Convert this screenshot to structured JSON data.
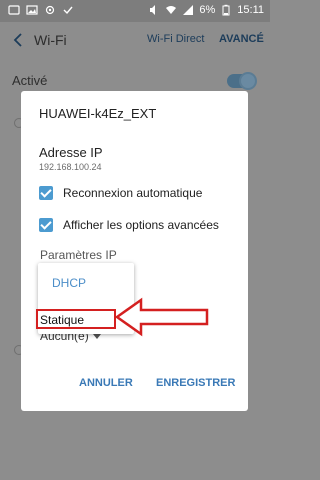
{
  "status_bar": {
    "battery": "6%",
    "time": "15:11"
  },
  "app_bar": {
    "title": "Wi-Fi",
    "wifi_direct": "Wi-Fi Direct",
    "advanced": "AVANCÉ"
  },
  "background": {
    "active_label": "Activé",
    "toggle_on": true
  },
  "dialog": {
    "network_name": "HUAWEI-k4Ez_EXT",
    "ip_label": "Adresse IP",
    "ip_value": "192.168.100.24",
    "auto_reconnect_label": "Reconnexion automatique",
    "auto_reconnect_checked": true,
    "show_advanced_label": "Afficher les options avancées",
    "show_advanced_checked": true,
    "ip_params_label": "Paramètres IP",
    "dropdown_options": [
      "DHCP",
      "Statique"
    ],
    "under_value": "Aucun(e)",
    "cancel_label": "ANNULER",
    "save_label": "ENREGISTRER"
  },
  "colors": {
    "accent": "#3a79b6",
    "checkbox": "#4c9bd0",
    "highlight": "#d42020"
  }
}
